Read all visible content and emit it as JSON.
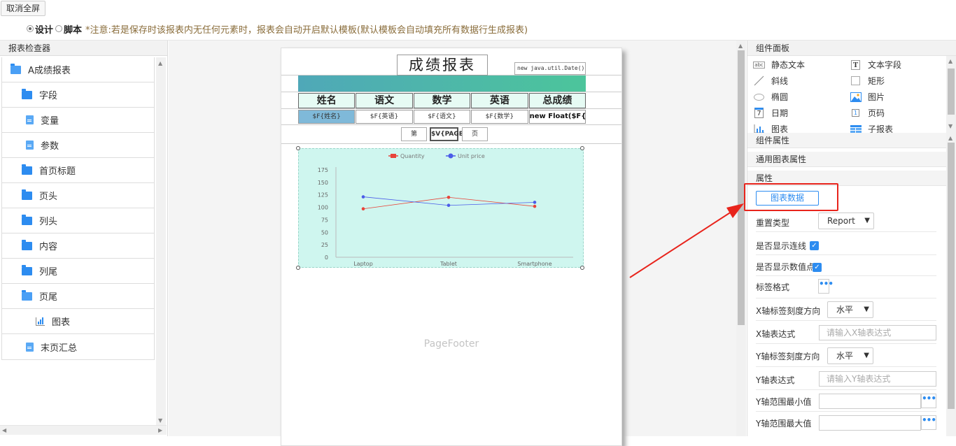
{
  "topbar": {
    "fullscreen_cancel": "取消全屏",
    "mode_design": "设计",
    "mode_script": "脚本",
    "notice": "*注意:若是保存时该报表内无任何元素时，报表会自动开启默认模板(默认模板会自动填充所有数据行生成报表)"
  },
  "inspector": {
    "title": "报表检查器",
    "items": [
      {
        "label": "A成绩报表",
        "icon": "folder-open-icon"
      },
      {
        "label": "字段",
        "icon": "folder-icon"
      },
      {
        "label": "变量",
        "icon": "file-icon"
      },
      {
        "label": "参数",
        "icon": "file-icon"
      },
      {
        "label": "首页标题",
        "icon": "folder-icon"
      },
      {
        "label": "页头",
        "icon": "folder-icon"
      },
      {
        "label": "列头",
        "icon": "folder-icon"
      },
      {
        "label": "内容",
        "icon": "folder-icon"
      },
      {
        "label": "列尾",
        "icon": "folder-icon"
      },
      {
        "label": "页尾",
        "icon": "folder-open-icon"
      },
      {
        "label": "图表",
        "icon": "bar-chart-icon"
      },
      {
        "label": "末页汇总",
        "icon": "file-icon"
      }
    ]
  },
  "report": {
    "title": "成绩报表",
    "date_expr": "new java.util.Date()",
    "headers": [
      "姓名",
      "语文",
      "数学",
      "英语",
      "总成绩"
    ],
    "row": [
      "$F{姓名}",
      "$F{英语}",
      "$F{语文}",
      "$F{数学}",
      "new Float($F{语"
    ],
    "pager": {
      "prefix": "第",
      "var": "$V{PAGE",
      "suffix": "页"
    },
    "page_footer": "PageFooter"
  },
  "chart_data": {
    "type": "line",
    "categories": [
      "Laptop",
      "Tablet",
      "Smartphone"
    ],
    "series": [
      {
        "name": "Quantity",
        "values": [
          97,
          120,
          102
        ],
        "color": "#e8443a"
      },
      {
        "name": "Unit price",
        "values": [
          121,
          104,
          110
        ],
        "color": "#4b5ce8"
      }
    ],
    "yticks": [
      0,
      25,
      50,
      75,
      100,
      125,
      150,
      175
    ],
    "ylim": [
      0,
      175
    ],
    "legend": "top-center",
    "grid": false
  },
  "components": {
    "title": "组件面板",
    "items": [
      {
        "label": "静态文本",
        "icon": "static-text-icon"
      },
      {
        "label": "文本字段",
        "icon": "text-field-icon"
      },
      {
        "label": "斜线",
        "icon": "slash-line-icon"
      },
      {
        "label": "矩形",
        "icon": "rectangle-icon"
      },
      {
        "label": "椭圆",
        "icon": "ellipse-icon"
      },
      {
        "label": "图片",
        "icon": "image-icon"
      },
      {
        "label": "日期",
        "icon": "calendar-icon"
      },
      {
        "label": "页码",
        "icon": "page-number-icon"
      },
      {
        "label": "图表",
        "icon": "chart-icon"
      },
      {
        "label": "子报表",
        "icon": "subreport-icon"
      }
    ]
  },
  "properties": {
    "component_props": "组件属性",
    "common_chart_props": "通用图表属性",
    "props": "属性",
    "chart_data_button": "图表数据",
    "reset_type_label": "重置类型",
    "reset_type_value": "Report",
    "show_lines_label": "是否显示连线",
    "show_values_label": "是否显示数值点",
    "label_format_label": "标签格式",
    "x_tick_dir_label": "X轴标签刻度方向",
    "x_tick_dir_value": "水平",
    "x_expr_label": "X轴表达式",
    "x_expr_placeholder": "请输入X轴表达式",
    "y_tick_dir_label": "Y轴标签刻度方向",
    "y_tick_dir_value": "水平",
    "y_expr_label": "Y轴表达式",
    "y_expr_placeholder": "请输入Y轴表达式",
    "y_min_label": "Y轴范围最小值",
    "y_max_label": "Y轴范围最大值",
    "dots": "•••"
  },
  "colors": {
    "accent": "#2d8cf0",
    "highlight_red": "#e8241c",
    "chart_bg": "#cff6ef"
  }
}
